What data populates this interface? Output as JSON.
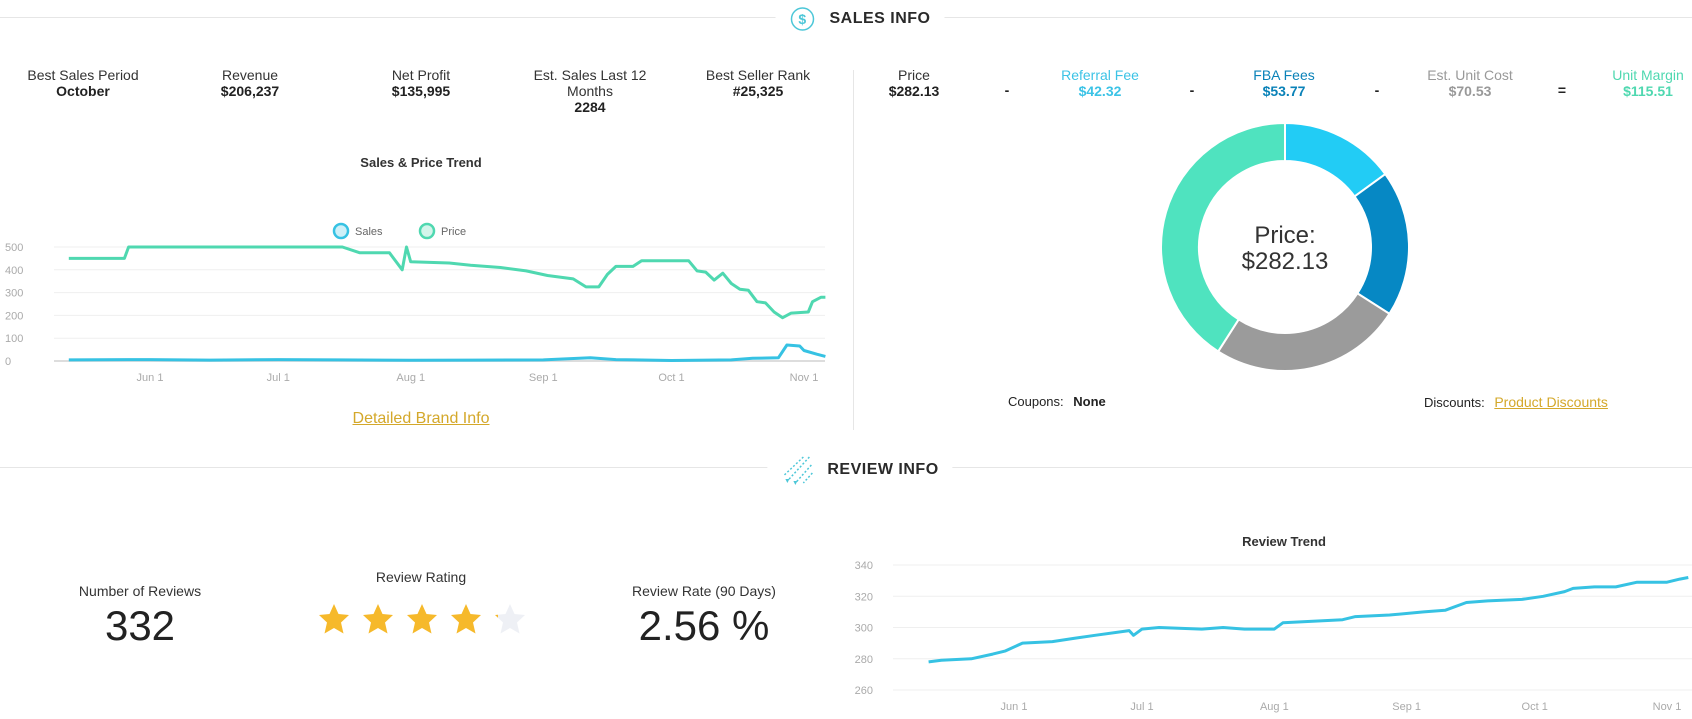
{
  "sales_info": {
    "title": "SALES INFO",
    "icon": "dollar-circle-icon",
    "stats": [
      {
        "label": "Best Sales Period",
        "value": "October"
      },
      {
        "label": "Revenue",
        "value": "$206,237"
      },
      {
        "label": "Net Profit",
        "value": "$135,995"
      },
      {
        "label": "Est. Sales Last 12 Months",
        "value": "2284"
      },
      {
        "label": "Best Seller Rank",
        "value": "#25,325"
      }
    ],
    "breakdown": [
      {
        "label": "Price",
        "value": "$282.13",
        "color": "#222222"
      },
      {
        "label": "Referral Fee",
        "value": "$42.32",
        "color": "#3cc3e6"
      },
      {
        "label": "FBA Fees",
        "value": "$53.77",
        "color": "#0a82b8"
      },
      {
        "label": "Est. Unit Cost",
        "value": "$70.53",
        "color": "#999999"
      },
      {
        "label": "Unit Margin",
        "value": "$115.51",
        "color": "#4fd8b0"
      }
    ],
    "operators": [
      "-",
      "-",
      "-",
      "="
    ],
    "donut": {
      "center_label": "Price:",
      "center_value": "$282.13",
      "segments": [
        {
          "name": "Referral Fee",
          "value": 42.32,
          "color": "#22ccf5"
        },
        {
          "name": "FBA Fees",
          "value": 53.77,
          "color": "#0688c4"
        },
        {
          "name": "Est. Unit Cost",
          "value": 70.53,
          "color": "#9b9b9b"
        },
        {
          "name": "Unit Margin",
          "value": 115.51,
          "color": "#4fe3bf"
        }
      ]
    },
    "coupons_label": "Coupons:",
    "coupons_value": "None",
    "discounts_label": "Discounts:",
    "discounts_link": "Product Discounts",
    "brand_link": "Detailed Brand Info"
  },
  "review_info": {
    "title": "REVIEW INFO",
    "icon": "shooting-stars-icon",
    "num_reviews_label": "Number of Reviews",
    "num_reviews": "332",
    "rating_label": "Review Rating",
    "rating": 4.1,
    "rating_max": 5,
    "rate_label": "Review Rate (90 Days)",
    "rate_value": "2.56 %"
  },
  "chart_data": [
    {
      "type": "line",
      "title": "Sales & Price Trend",
      "ylim": [
        0,
        500
      ],
      "yticks": [
        "0",
        "100",
        "200",
        "300",
        "400",
        "500"
      ],
      "xticks": [
        {
          "label": "Jun 1",
          "date": "06-01"
        },
        {
          "label": "Jul 1",
          "date": "07-01"
        },
        {
          "label": "Aug 1",
          "date": "08-01"
        },
        {
          "label": "Sep 1",
          "date": "09-01"
        },
        {
          "label": "Oct 1",
          "date": "10-01"
        },
        {
          "label": "Nov 1",
          "date": "11-01"
        }
      ],
      "grid": true,
      "legend": "top-center",
      "series": [
        {
          "name": "Sales",
          "color": "#36c2e3",
          "points": [
            [
              "05-13",
              5
            ],
            [
              "06-01",
              6
            ],
            [
              "06-15",
              4
            ],
            [
              "07-01",
              6
            ],
            [
              "07-15",
              5
            ],
            [
              "08-01",
              3
            ],
            [
              "08-15",
              4
            ],
            [
              "09-01",
              5
            ],
            [
              "09-12",
              14
            ],
            [
              "09-18",
              6
            ],
            [
              "10-01",
              2
            ],
            [
              "10-15",
              5
            ],
            [
              "10-20",
              12
            ],
            [
              "10-26",
              14
            ],
            [
              "10-28",
              70
            ],
            [
              "10-31",
              66
            ],
            [
              "11-01",
              46
            ],
            [
              "11-04",
              30
            ],
            [
              "11-06",
              20
            ]
          ]
        },
        {
          "name": "Price",
          "color": "#4fd8b0",
          "points": [
            [
              "05-13",
              450
            ],
            [
              "05-26",
              450
            ],
            [
              "05-27",
              500
            ],
            [
              "07-16",
              500
            ],
            [
              "07-20",
              475
            ],
            [
              "07-27",
              475
            ],
            [
              "07-30",
              400
            ],
            [
              "07-31",
              500
            ],
            [
              "08-01",
              435
            ],
            [
              "08-10",
              430
            ],
            [
              "08-15",
              420
            ],
            [
              "08-22",
              410
            ],
            [
              "08-28",
              395
            ],
            [
              "09-02",
              375
            ],
            [
              "09-08",
              360
            ],
            [
              "09-11",
              325
            ],
            [
              "09-14",
              325
            ],
            [
              "09-16",
              380
            ],
            [
              "09-18",
              415
            ],
            [
              "09-22",
              415
            ],
            [
              "09-24",
              440
            ],
            [
              "10-05",
              440
            ],
            [
              "10-07",
              395
            ],
            [
              "10-09",
              390
            ],
            [
              "10-11",
              355
            ],
            [
              "10-13",
              385
            ],
            [
              "10-15",
              340
            ],
            [
              "10-17",
              315
            ],
            [
              "10-19",
              310
            ],
            [
              "10-21",
              260
            ],
            [
              "10-23",
              255
            ],
            [
              "10-25",
              215
            ],
            [
              "10-27",
              190
            ],
            [
              "10-29",
              210
            ],
            [
              "11-02",
              215
            ],
            [
              "11-03",
              260
            ],
            [
              "11-05",
              280
            ],
            [
              "11-06",
              280
            ]
          ]
        }
      ]
    },
    {
      "type": "line",
      "title": "Review Trend",
      "ylim": [
        260,
        340
      ],
      "yticks": [
        "260",
        "280",
        "300",
        "320",
        "340"
      ],
      "xticks": [
        {
          "label": "Jun 1",
          "date": "06-01"
        },
        {
          "label": "Jul 1",
          "date": "07-01"
        },
        {
          "label": "Aug 1",
          "date": "08-01"
        },
        {
          "label": "Sep 1",
          "date": "09-01"
        },
        {
          "label": "Oct 1",
          "date": "10-01"
        },
        {
          "label": "Nov 1",
          "date": "11-01"
        }
      ],
      "grid": true,
      "series": [
        {
          "color": "#36c2e3",
          "points": [
            [
              "05-12",
              278
            ],
            [
              "05-15",
              279
            ],
            [
              "05-22",
              280
            ],
            [
              "05-27",
              283
            ],
            [
              "05-30",
              285
            ],
            [
              "06-03",
              290
            ],
            [
              "06-10",
              291
            ],
            [
              "06-15",
              293
            ],
            [
              "06-20",
              295
            ],
            [
              "06-28",
              298
            ],
            [
              "06-29",
              295
            ],
            [
              "07-01",
              299
            ],
            [
              "07-05",
              300
            ],
            [
              "07-15",
              299
            ],
            [
              "07-20",
              300
            ],
            [
              "07-25",
              299
            ],
            [
              "08-01",
              299
            ],
            [
              "08-03",
              303
            ],
            [
              "08-10",
              304
            ],
            [
              "08-17",
              305
            ],
            [
              "08-20",
              307
            ],
            [
              "08-28",
              308
            ],
            [
              "09-05",
              310
            ],
            [
              "09-10",
              311
            ],
            [
              "09-15",
              316
            ],
            [
              "09-20",
              317
            ],
            [
              "09-28",
              318
            ],
            [
              "10-03",
              320
            ],
            [
              "10-08",
              323
            ],
            [
              "10-10",
              325
            ],
            [
              "10-15",
              326
            ],
            [
              "10-20",
              326
            ],
            [
              "10-25",
              329
            ],
            [
              "11-01",
              329
            ],
            [
              "11-04",
              331
            ],
            [
              "11-06",
              332
            ]
          ]
        }
      ]
    }
  ]
}
